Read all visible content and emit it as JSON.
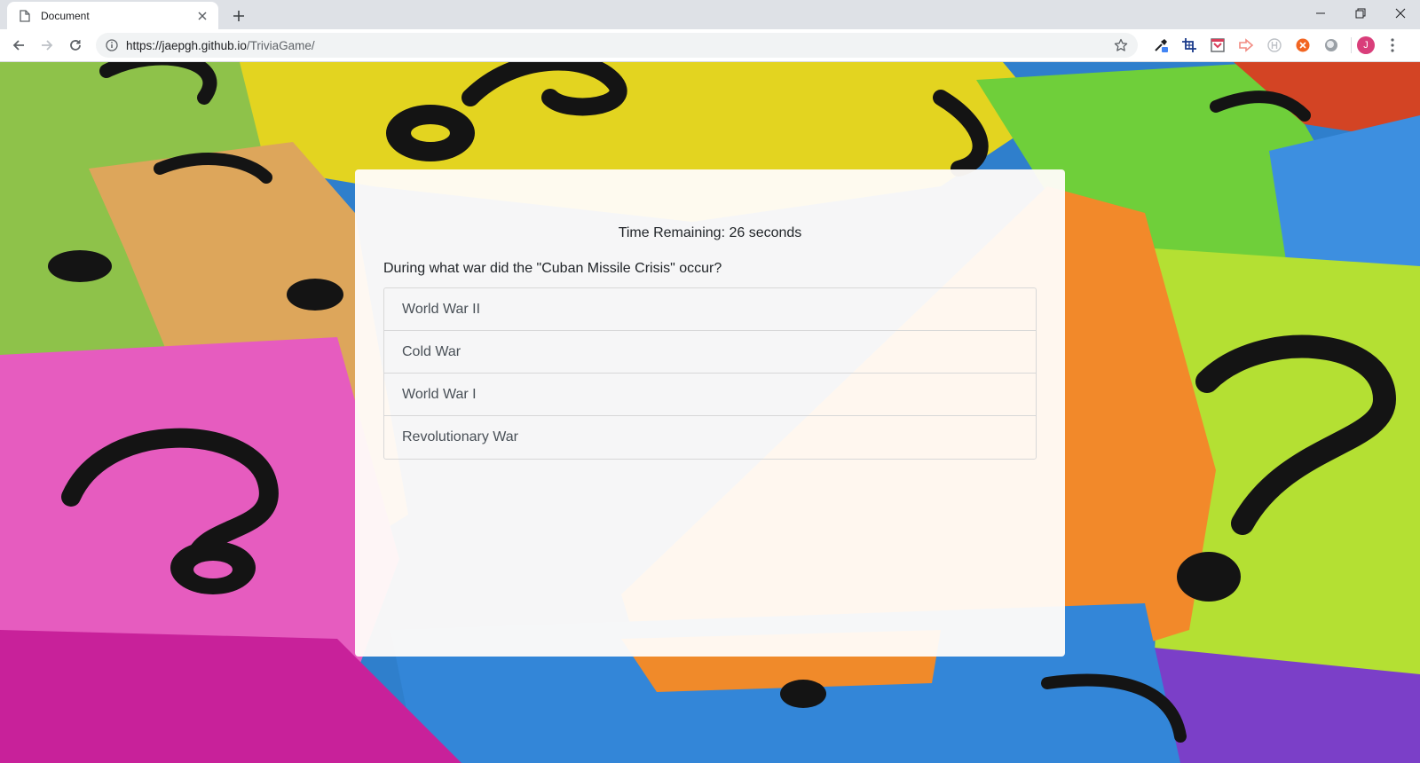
{
  "browser": {
    "tab_title": "Document",
    "url_host": "https://jaepgh.github.io",
    "url_path": "/TriviaGame/",
    "avatar_letter": "J",
    "icons": {
      "tab_favicon": "document-icon",
      "tab_close": "close-icon",
      "new_tab": "plus-icon",
      "back": "back-arrow-icon",
      "forward": "forward-arrow-icon",
      "reload": "reload-icon",
      "site_info": "info-icon",
      "bookmark": "star-icon",
      "menu": "vertical-dots-icon"
    },
    "extensions": [
      "eyedropper-icon",
      "crop-icon",
      "pocket-icon",
      "arrow-ext-icon",
      "h-ext-icon",
      "orange-ext-icon",
      "circle-ext-icon"
    ]
  },
  "trivia": {
    "timer_text": "Time Remaining: 26 seconds",
    "question": "During what war did the \"Cuban Missile Crisis\" occur?",
    "answers": [
      "World War II",
      "Cold War",
      "World War I",
      "Revolutionary War"
    ]
  },
  "colors": {
    "card_bg": "#fffcf9",
    "text": "#212529",
    "answer_text": "#495057",
    "avatar": "#d93e7a"
  }
}
